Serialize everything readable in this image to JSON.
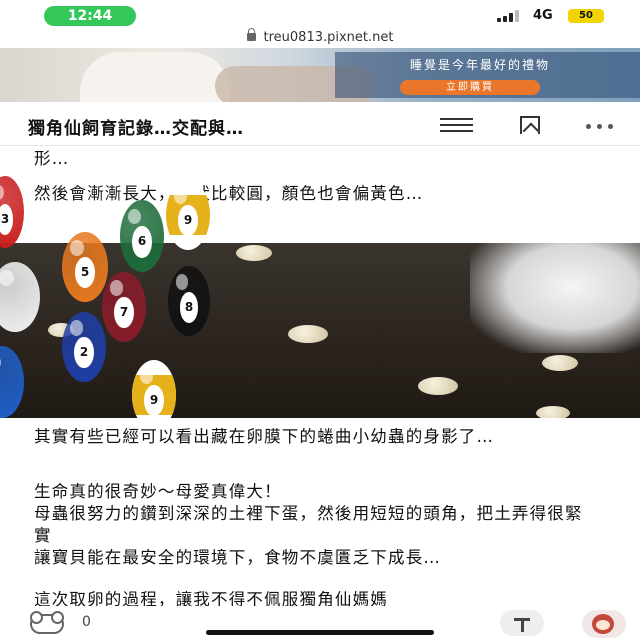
{
  "status_bar": {
    "time": "12:44",
    "network": "4G",
    "battery": "50"
  },
  "browser": {
    "url": "treu0813.pixnet.net"
  },
  "ad": {
    "headline": "睡覺是今年最好的禮物",
    "cta": "立即購買"
  },
  "header": {
    "title": "獨角仙飼育記錄…交配與…"
  },
  "article": {
    "p1": "形…",
    "p2": "然後會漸漸長大，形狀比較圓，顏色也會偏黃色…",
    "p3": "其實有些已經可以看出藏在卵膜下的蜷曲小幼蟲的身影了…",
    "p4": "生命真的很奇妙～母愛真偉大！\n母蟲很努力的鑽到深深的土裡下蛋，然後用短短的頭角，把土弄得很緊實\n讓寶貝能在最安全的環境下，食物不虞匱乏下成長…",
    "p5": "這次取卵的過程，讓我不得不佩服獨角仙媽媽"
  },
  "overlay_balls": [
    {
      "number": "6",
      "color": "#1d6b3a",
      "striped": false
    },
    {
      "number": "9",
      "color": "#e6b21c",
      "striped": true
    },
    {
      "number": "8",
      "color": "#111111",
      "striped": false
    },
    {
      "number": "9",
      "color": "#e6b21c",
      "striped": true
    },
    {
      "number": "5",
      "color": "#e8791f",
      "striped": false
    },
    {
      "number": "7",
      "color": "#8a1c2a",
      "striped": false
    },
    {
      "number": "2",
      "color": "#1f3fa8",
      "striped": false
    },
    {
      "number": "3",
      "color": "#c81e1e",
      "striped": false
    }
  ],
  "bottom_bar": {
    "reaction_count": "0"
  },
  "colors": {
    "status_green": "#34c759",
    "cta_orange": "#e9762b",
    "battery_yellow": "#f2d400"
  }
}
